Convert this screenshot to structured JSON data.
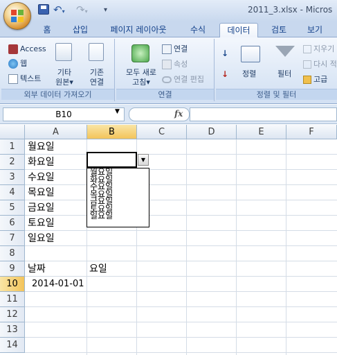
{
  "titlebar": {
    "title": "2011_3.xlsx - Micros",
    "qat_undo_icon": "undo-icon",
    "qat_redo_icon": "redo-icon"
  },
  "tabs": [
    {
      "label": "홈",
      "active": false
    },
    {
      "label": "삽입",
      "active": false
    },
    {
      "label": "페이지 레이아웃",
      "active": false
    },
    {
      "label": "수식",
      "active": false
    },
    {
      "label": "데이터",
      "active": true
    },
    {
      "label": "검토",
      "active": false
    },
    {
      "label": "보기",
      "active": false
    }
  ],
  "ribbon": {
    "external": {
      "label": "외부 데이터 가져오기",
      "access": "Access",
      "web": "웹",
      "text": "텍스트",
      "other_line1": "기타",
      "other_line2": "원본",
      "existing_line1": "기존",
      "existing_line2": "연결"
    },
    "connections": {
      "label": "연결",
      "refresh_line1": "모두 새로",
      "refresh_line2": "고침",
      "connect": "연결",
      "properties": "속성",
      "edit_links": "연결 편집"
    },
    "sort_filter": {
      "label": "정렬 및 필터",
      "sort_az_icon": "sort-az-icon",
      "sort_za_icon": "sort-za-icon",
      "sort_dialog_icon": "sort-dialog-icon",
      "sort": "정렬",
      "filter": "필터",
      "clear": "지우기",
      "reapply": "다시 적",
      "advanced": "고급"
    }
  },
  "formula_bar": {
    "name_box": "B10",
    "fx": "fx",
    "formula": ""
  },
  "sheet": {
    "columns": [
      "A",
      "B",
      "C",
      "D",
      "E",
      "F"
    ],
    "rows": [
      "1",
      "2",
      "3",
      "4",
      "5",
      "6",
      "7",
      "8",
      "9",
      "10",
      "11",
      "12",
      "13",
      "14"
    ],
    "cells": {
      "A1": "월요일",
      "A2": "화요일",
      "A3": "수요일",
      "A4": "목요일",
      "A5": "금요일",
      "A6": "토요일",
      "A7": "일요일",
      "A9": "날짜",
      "B9": "요일",
      "A10": "2014-01-01"
    }
  },
  "dropdown": {
    "arrow_icon": "dropdown-arrow-icon",
    "options": [
      "월요일",
      "화요일",
      "수요일",
      "목요일",
      "금요일",
      "토요일",
      "일요일"
    ]
  },
  "colors": {
    "selected_header": "#f3c45a",
    "ribbon_bg": "#dde8f6",
    "tab_text": "#15428b"
  }
}
